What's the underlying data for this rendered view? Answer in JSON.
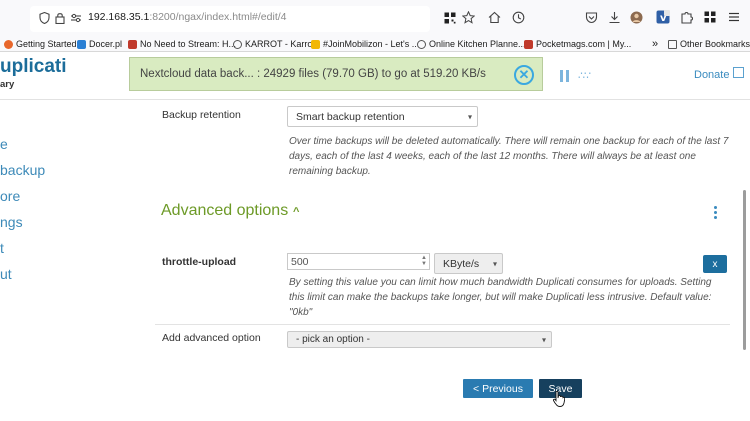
{
  "browser": {
    "url_host": "192.168.35.1",
    "url_rest": ":8200/ngax/index.html#/edit/4",
    "bookmarks": [
      {
        "label": "Getting Started",
        "color": "#e8672b"
      },
      {
        "label": "Docer.pl",
        "color": "#2a7fd4"
      },
      {
        "label": "No Need to Stream: H...",
        "color": "#c0392b"
      },
      {
        "label": "KARROT - Karrot",
        "color": "#555555"
      },
      {
        "label": "#JoinMobilizon - Let's ...",
        "color": "#f2b705"
      },
      {
        "label": "Online Kitchen Planne...",
        "color": "#555555"
      },
      {
        "label": "Pocketmags.com | My...",
        "color": "#c0392b"
      }
    ],
    "other_bookmarks": "Other Bookmarks",
    "overflow": "»"
  },
  "app": {
    "logo": "uplicati",
    "logo_sub": "ary",
    "progress_text": "Nextcloud data back... : 24929 files (79.70 GB) to go at 519.20 KB/s",
    "donate": "Donate",
    "accent": "#1c6d9a",
    "green": "#6d9a27"
  },
  "sidebar": {
    "items": [
      "e",
      "backup",
      "ore",
      "ngs",
      "t",
      "ut"
    ]
  },
  "form": {
    "retention_label": "Backup retention",
    "retention_value": "Smart backup retention",
    "retention_help": "Over time backups will be deleted automatically. There will remain one backup for each of the last 7 days, each of the last 4 weeks, each of the last 12 months. There will always be at least one remaining backup.",
    "advanced_title": "Advanced options",
    "throttle_label": "throttle-upload",
    "throttle_value": "500",
    "throttle_unit": "KByte/s",
    "remove_label": "x",
    "throttle_help": "By setting this value you can limit how much bandwidth Duplicati consumes for uploads. Setting this limit can make the backups take longer, but will make Duplicati less intrusive. Default value: \"0kb\"",
    "add_label": "Add advanced option",
    "add_placeholder": "- pick an option -",
    "previous_label": "< Previous",
    "save_label": "Save"
  }
}
